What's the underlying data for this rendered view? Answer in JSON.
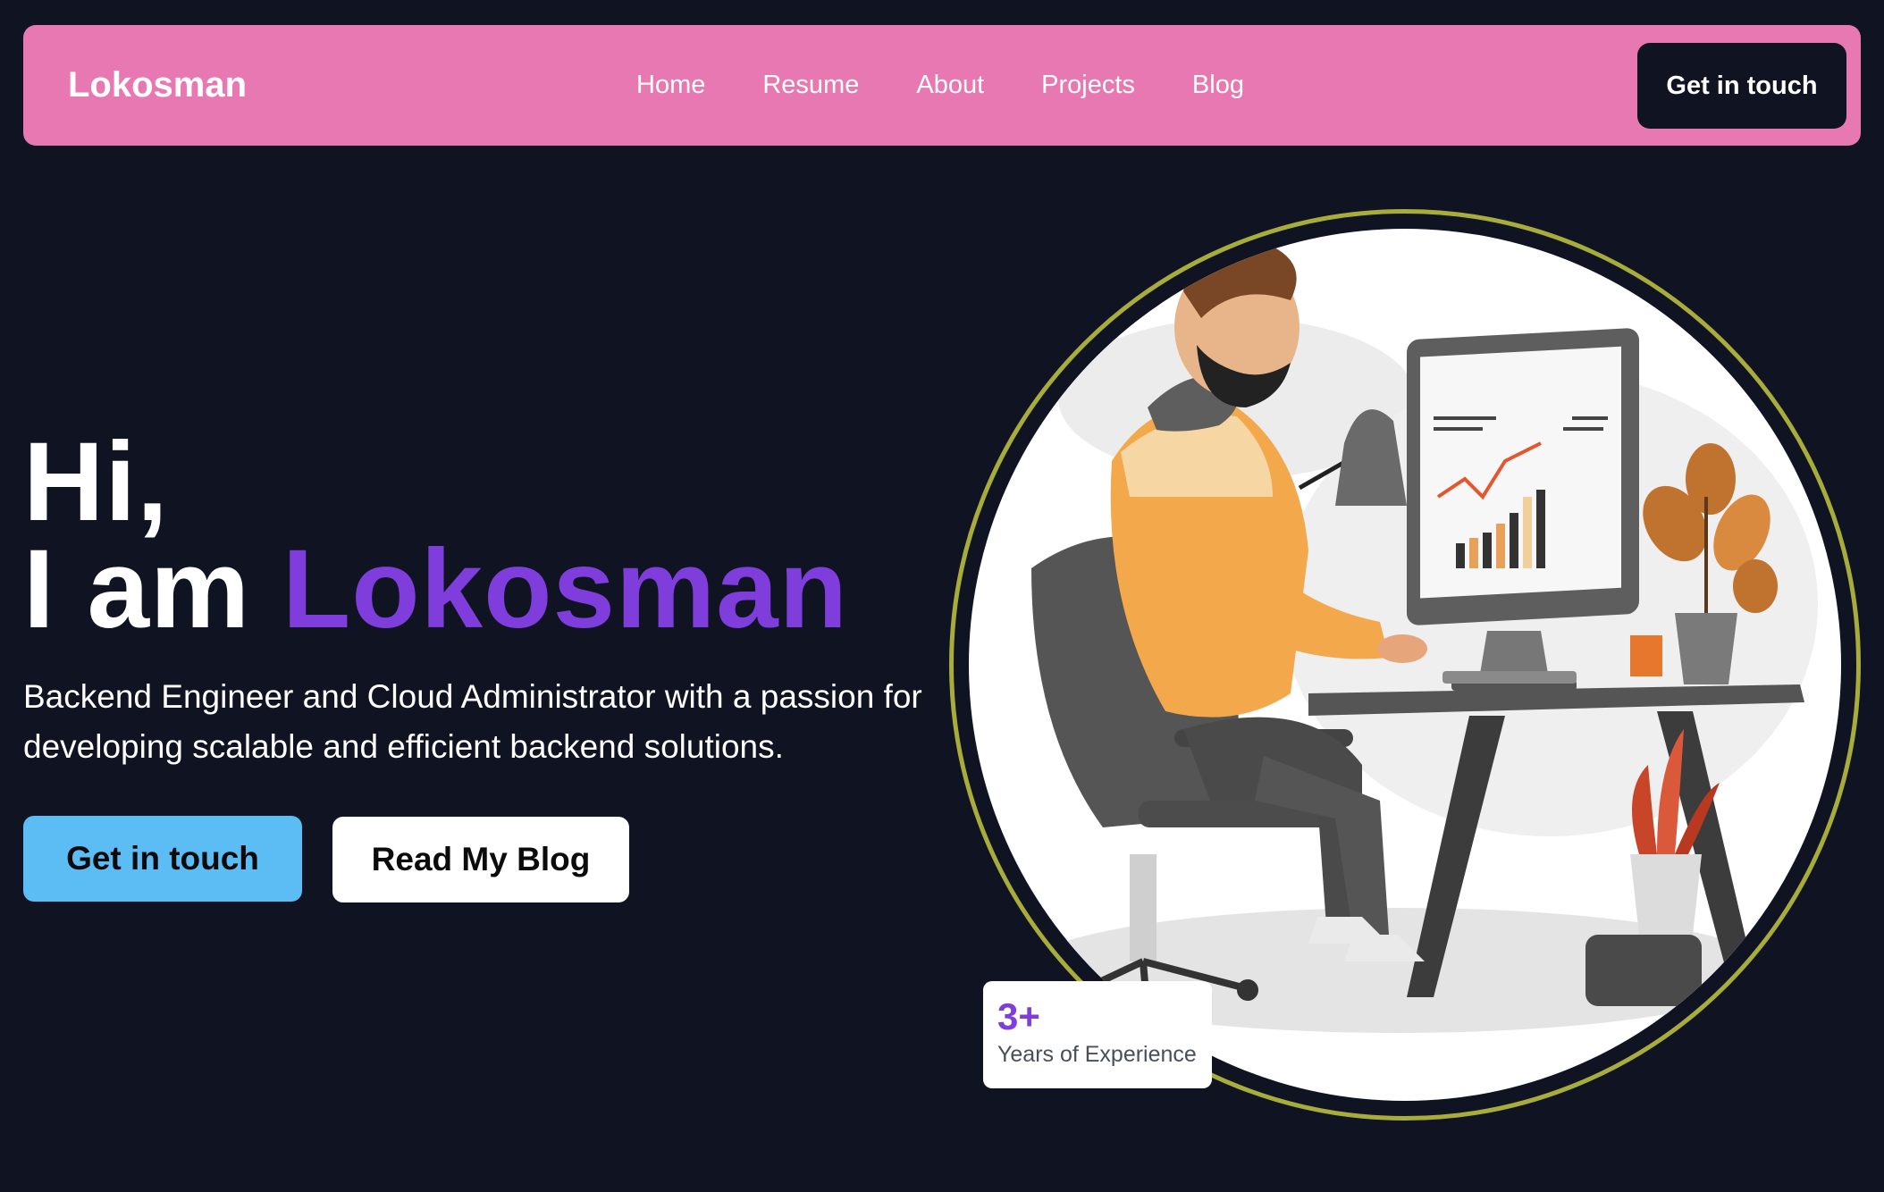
{
  "nav": {
    "brand": "Lokosman",
    "links": [
      {
        "label": "Home"
      },
      {
        "label": "Resume"
      },
      {
        "label": "About"
      },
      {
        "label": "Projects"
      },
      {
        "label": "Blog"
      }
    ],
    "cta": "Get in touch"
  },
  "hero": {
    "greeting": "Hi,",
    "intro": "I am",
    "name": "Lokosman",
    "description": "Backend Engineer and Cloud Administrator with a passion for developing scalable and efficient backend solutions.",
    "primary_button": "Get in touch",
    "secondary_button": "Read My Blog"
  },
  "illustration": {
    "subject": "man-working-at-computer-illustration"
  },
  "badge": {
    "value": "3+",
    "label": "Years of Experience"
  },
  "colors": {
    "background": "#0f1322",
    "navbar": "#e778b2",
    "accent_purple": "#7f3ddc",
    "primary_button": "#5cbcf4",
    "ring": "#a8ac3a"
  }
}
